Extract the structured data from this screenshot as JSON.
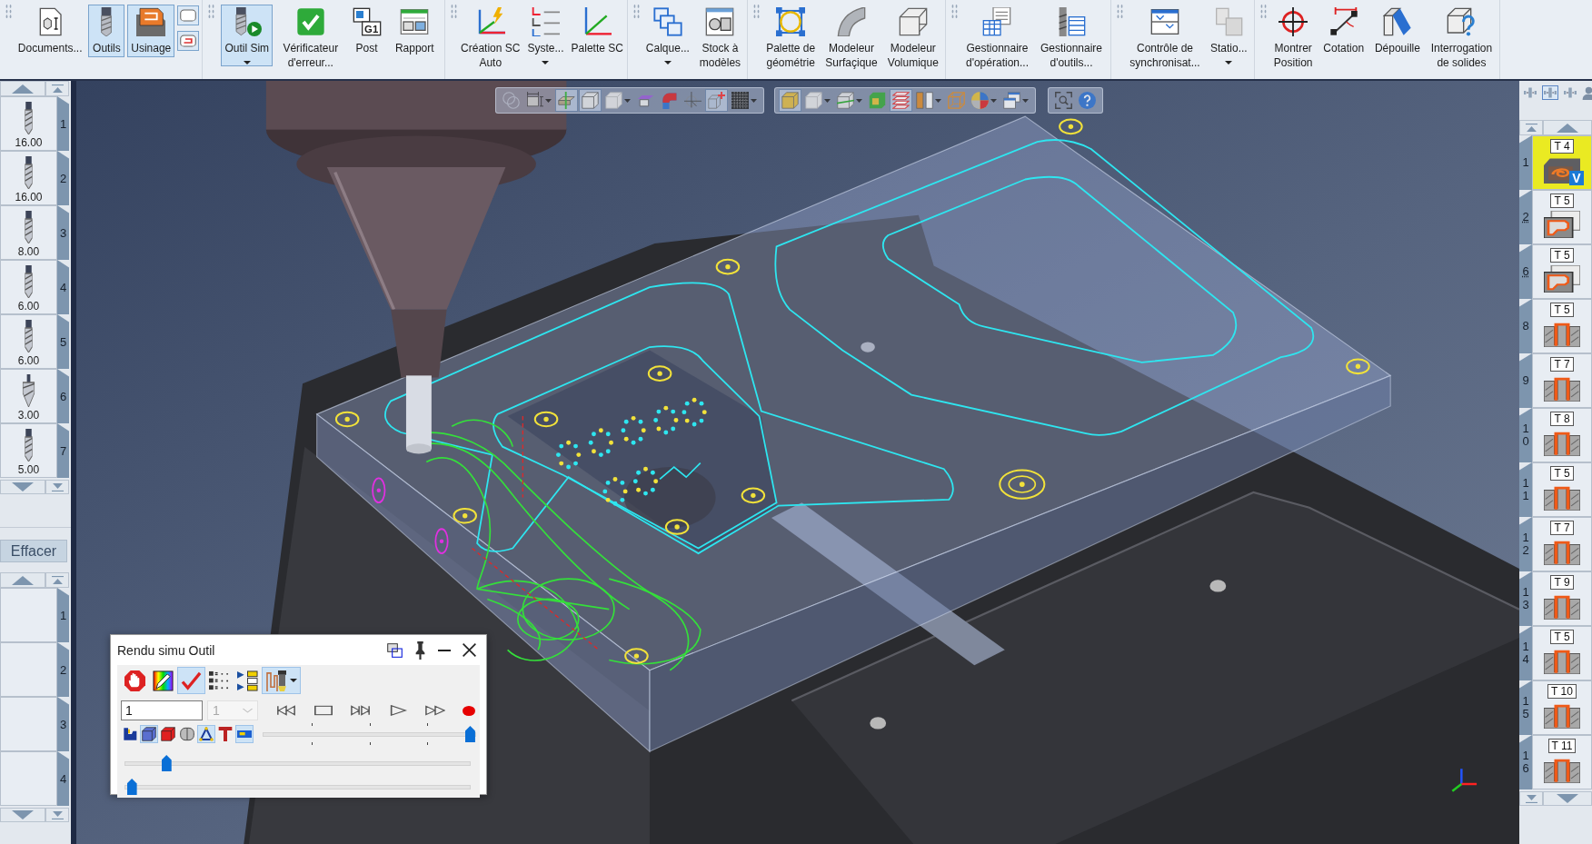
{
  "ribbon": {
    "groups": [
      {
        "items": [
          {
            "label": "Documents...",
            "selected": false,
            "dropdown": false
          },
          {
            "label": "Outils",
            "selected": true,
            "dropdown": false
          },
          {
            "label": "Usinage",
            "selected": true,
            "dropdown": false
          }
        ],
        "small_buttons": [
          {
            "selected": true
          },
          {
            "selected": true
          }
        ]
      },
      {
        "items": [
          {
            "label": "Outil Sim",
            "selected": true,
            "dropdown": true
          },
          {
            "label": "Vérificateur\nd'erreur...",
            "selected": false,
            "dropdown": false
          },
          {
            "label": "Post",
            "icon_text": "G1",
            "selected": false,
            "dropdown": false
          },
          {
            "label": "Rapport",
            "selected": false,
            "dropdown": false
          }
        ]
      },
      {
        "items": [
          {
            "label": "Création SC\nAuto",
            "selected": false,
            "dropdown": false
          },
          {
            "label": "Syste...",
            "selected": false,
            "dropdown": true
          },
          {
            "label": "Palette SC",
            "selected": false,
            "dropdown": false
          }
        ]
      },
      {
        "items": [
          {
            "label": "Calque...",
            "selected": false,
            "dropdown": true
          },
          {
            "label": "Stock à\nmodèles",
            "selected": false,
            "dropdown": false
          }
        ]
      },
      {
        "items": [
          {
            "label": "Palette de\ngéométrie",
            "selected": false,
            "dropdown": false
          },
          {
            "label": "Modeleur\nSurfaçique",
            "selected": false,
            "dropdown": false
          },
          {
            "label": "Modeleur\nVolumique",
            "selected": false,
            "dropdown": false
          }
        ]
      },
      {
        "items": [
          {
            "label": "Gestionnaire\nd'opération...",
            "selected": false,
            "dropdown": false
          },
          {
            "label": "Gestionnaire\nd'outils...",
            "selected": false,
            "dropdown": false
          }
        ]
      },
      {
        "items": [
          {
            "label": "Contrôle de\nsynchronisat...",
            "selected": false,
            "dropdown": false
          },
          {
            "label": "Statio...",
            "selected": false,
            "dropdown": true
          }
        ]
      },
      {
        "items": [
          {
            "label": "Montrer\nPosition",
            "selected": false,
            "dropdown": false
          },
          {
            "label": "Cotation",
            "selected": false,
            "dropdown": false
          },
          {
            "label": "Dépouille",
            "selected": false,
            "dropdown": false
          },
          {
            "label": "Interrogation\nde solides",
            "selected": false,
            "dropdown": false
          }
        ]
      }
    ]
  },
  "tool_list_panel": {
    "tools": [
      {
        "number": "1",
        "diameter": "16.00"
      },
      {
        "number": "2",
        "diameter": "16.00"
      },
      {
        "number": "3",
        "diameter": "8.00"
      },
      {
        "number": "4",
        "diameter": "6.00"
      },
      {
        "number": "5",
        "diameter": "6.00"
      },
      {
        "number": "6",
        "diameter": "3.00"
      },
      {
        "number": "7",
        "diameter": "5.00"
      }
    ],
    "clear_button": "Effacer",
    "slots": [
      {
        "number": "1"
      },
      {
        "number": "2"
      },
      {
        "number": "3"
      },
      {
        "number": "4"
      }
    ]
  },
  "viewport": {
    "toolbars": [
      {
        "buttons": [
          {
            "selected": false,
            "dropdown": false
          },
          {
            "selected": false,
            "dropdown": true
          },
          {
            "selected": true,
            "dropdown": false
          },
          {
            "selected": true,
            "dropdown": false
          },
          {
            "selected": false,
            "dropdown": true
          },
          {
            "selected": false,
            "dropdown": false
          },
          {
            "selected": false,
            "dropdown": false
          },
          {
            "selected": false,
            "dropdown": false
          },
          {
            "selected": true,
            "dropdown": false
          },
          {
            "selected": false,
            "dropdown": true
          }
        ]
      },
      {
        "buttons": [
          {
            "selected": true,
            "dropdown": false
          },
          {
            "selected": false,
            "dropdown": true
          },
          {
            "selected": false,
            "dropdown": true
          },
          {
            "selected": false,
            "dropdown": false
          },
          {
            "selected": true,
            "dropdown": false
          },
          {
            "selected": false,
            "dropdown": true
          },
          {
            "selected": false,
            "dropdown": false
          },
          {
            "selected": false,
            "dropdown": true
          },
          {
            "selected": false,
            "dropdown": true
          }
        ]
      },
      {
        "buttons": [
          {
            "selected": false,
            "dropdown": false
          },
          {
            "selected": false,
            "dropdown": false
          }
        ]
      }
    ]
  },
  "tool_sim_dialog": {
    "title": "Rendu simu Outil",
    "toolbar": [
      {
        "selected": false,
        "dropdown": false
      },
      {
        "selected": false,
        "dropdown": false
      },
      {
        "selected": true,
        "dropdown": false
      },
      {
        "selected": false,
        "dropdown": false
      },
      {
        "selected": false,
        "dropdown": false
      },
      {
        "selected": true,
        "dropdown": true
      }
    ],
    "step_field": {
      "value": "1"
    },
    "step_combo": {
      "value": "1",
      "disabled": true
    },
    "display_toggles": [
      {
        "selected": false
      },
      {
        "selected": true
      },
      {
        "selected": false
      },
      {
        "selected": false
      },
      {
        "selected": true
      },
      {
        "selected": false
      },
      {
        "selected": true
      }
    ],
    "sliders": [
      {
        "kind": "ticked",
        "level": 0.97
      },
      {
        "kind": "plain",
        "level": 0.12
      },
      {
        "kind": "plain",
        "level": 0.02
      }
    ]
  },
  "operations_panel": {
    "view_buttons": [
      {
        "selected": false
      },
      {
        "selected": true
      },
      {
        "selected": false
      }
    ],
    "operations": [
      {
        "number": "1",
        "tool": "T 4",
        "kind": "surface",
        "badge": "V",
        "selected": true,
        "number_underlined": false
      },
      {
        "number": "2",
        "tool": "T 5",
        "kind": "pocket",
        "selected": false,
        "number_underlined": true
      },
      {
        "number": "6",
        "tool": "T 5",
        "kind": "pocket",
        "selected": false,
        "number_underlined": true
      },
      {
        "number": "8",
        "tool": "T 5",
        "kind": "slot",
        "selected": false,
        "number_underlined": false
      },
      {
        "number": "9",
        "tool": "T 7",
        "kind": "slot",
        "selected": false,
        "number_underlined": false
      },
      {
        "number": "10",
        "tool": "T 8",
        "kind": "slot",
        "selected": false,
        "number_underlined": false
      },
      {
        "number": "11",
        "tool": "T 5",
        "kind": "slot",
        "selected": false,
        "number_underlined": false
      },
      {
        "number": "12",
        "tool": "T 7",
        "kind": "slot",
        "selected": false,
        "number_underlined": false
      },
      {
        "number": "13",
        "tool": "T 9",
        "kind": "slot",
        "selected": false,
        "number_underlined": false
      },
      {
        "number": "14",
        "tool": "T 5",
        "kind": "slot",
        "selected": false,
        "number_underlined": false
      },
      {
        "number": "15",
        "tool": "T 10",
        "kind": "slot",
        "selected": false,
        "number_underlined": false
      },
      {
        "number": "16",
        "tool": "T 11",
        "kind": "slot",
        "selected": false,
        "number_underlined": false
      }
    ]
  }
}
